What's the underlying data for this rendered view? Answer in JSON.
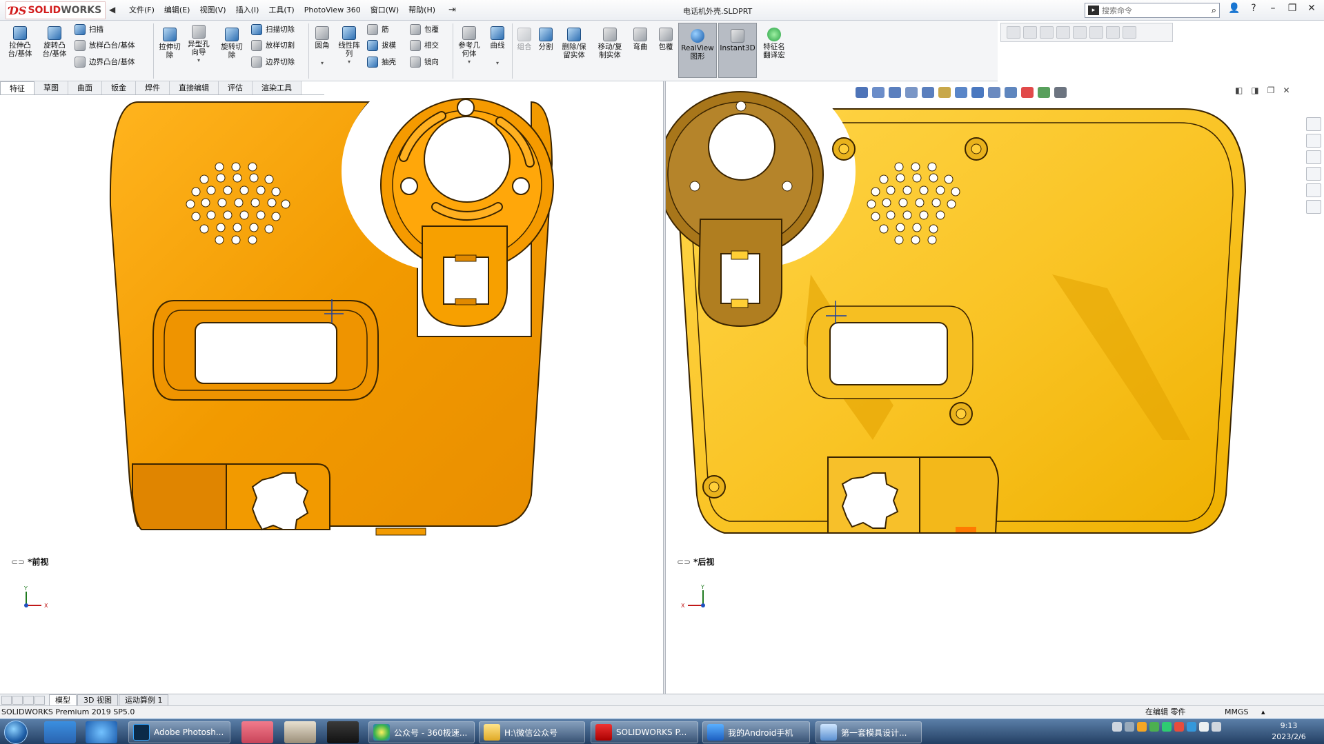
{
  "app": {
    "logo_ds": "ƊS",
    "logo_solid": "SOLID",
    "logo_works": "WORKS",
    "doc_title": "电话机外壳.SLDPRT"
  },
  "menu": [
    "文件(F)",
    "编辑(E)",
    "视图(V)",
    "插入(I)",
    "工具(T)",
    "PhotoView 360",
    "窗口(W)",
    "帮助(H)"
  ],
  "search": {
    "placeholder": "搜索命令"
  },
  "toolbar": {
    "extrude_boss": "拉伸凸\n台/基体",
    "revolve_boss": "旋转凸\n台/基体",
    "sweep": "扫描",
    "loft": "放样凸台/基体",
    "boundary_boss": "边界凸台/基体",
    "extrude_cut": "拉伸切\n除",
    "hole_wizard": "异型孔\n向导",
    "revolve_cut": "旋转切\n除",
    "sweep_cut": "扫描切除",
    "loft_cut": "放样切割",
    "boundary_cut": "边界切除",
    "fillet": "圆角",
    "linear_pattern": "线性阵\n列",
    "rib": "筋",
    "draft": "拔模",
    "shell": "抽壳",
    "wrap": "包覆",
    "intersect": "相交",
    "mirror": "镜向",
    "ref_geometry": "参考几\n何体",
    "curves": "曲线",
    "combine": "组合",
    "split": "分割",
    "delete_keep": "删除/保\n留实体",
    "move_copy": "移动/复\n制实体",
    "flex": "弯曲",
    "wrap2": "包覆",
    "realview": "RealView\n图形",
    "instant3d": "Instant3D",
    "feature_name": "特征名\n翻译宏"
  },
  "cmd_tabs": [
    "特征",
    "草图",
    "曲面",
    "钣金",
    "焊件",
    "直接编辑",
    "评估",
    "渲染工具"
  ],
  "views": {
    "left_label": "*前视",
    "right_label": "*后视"
  },
  "model_tabs": [
    "模型",
    "3D 视图",
    "运动算例 1"
  ],
  "status": {
    "left": "SOLIDWORKS Premium 2019 SP5.0",
    "editing": "在编辑 零件",
    "units": "MMGS"
  },
  "taskbar": {
    "items": [
      {
        "label": "Adobe Photosh..."
      },
      {
        "label": "公众号 - 360极速..."
      },
      {
        "label": "H:\\微信公众号"
      },
      {
        "label": "SOLIDWORKS P..."
      },
      {
        "label": "我的Android手机"
      },
      {
        "label": "第一套模具设计..."
      }
    ],
    "time": "9:13",
    "date": "2023/2/6"
  },
  "axes": {
    "x": "X",
    "y": "Y"
  },
  "colors": {
    "part_front": "#f2a100",
    "part_back": "#fcc21c",
    "highlight_box": "#b7bcc4",
    "taskbar": "#2b4a72"
  }
}
